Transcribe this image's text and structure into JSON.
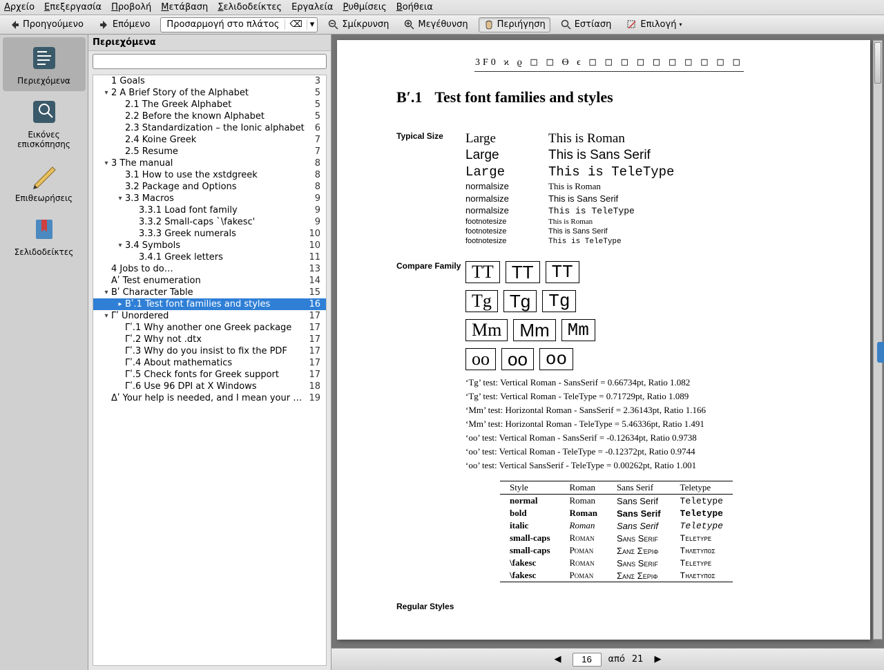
{
  "menus": [
    "Αρχείο",
    "Επεξεργασία",
    "Προβολή",
    "Μετάβαση",
    "Σελιδοδείκτες",
    "Εργαλεία",
    "Ρυθμίσεις",
    "Βοήθεια"
  ],
  "menu_ul": [
    0,
    0,
    0,
    0,
    0,
    -1,
    0,
    0
  ],
  "toolbar": {
    "prev": "Προηγούμενο",
    "next": "Επόμενο",
    "zoom_value": "Προσαρμογή στο πλάτος",
    "zoom_out": "Σμίκρυνση",
    "zoom_in": "Μεγέθυνση",
    "browse": "Περιήγηση",
    "focus": "Εστίαση",
    "select": "Επιλογή"
  },
  "leftbar": [
    {
      "key": "contents",
      "label": "Περιεχόμενα",
      "active": true
    },
    {
      "key": "thumbs",
      "label": "Εικόνες επισκόπησης",
      "active": false
    },
    {
      "key": "reviews",
      "label": "Επιθεωρήσεις",
      "active": false
    },
    {
      "key": "bookmarks",
      "label": "Σελιδοδείκτες",
      "active": false
    }
  ],
  "side": {
    "title": "Περιεχόμενα",
    "search_placeholder": "",
    "tree": [
      {
        "d": 0,
        "a": "",
        "t": "1 Goals",
        "p": 3
      },
      {
        "d": 0,
        "a": "▾",
        "t": "2 A Brief Story of the Alphabet",
        "p": 5
      },
      {
        "d": 1,
        "a": "",
        "t": "2.1 The Greek Alphabet",
        "p": 5
      },
      {
        "d": 1,
        "a": "",
        "t": "2.2 Before the known Alphabet",
        "p": 5
      },
      {
        "d": 1,
        "a": "",
        "t": "2.3 Standardization – the Ionic alphabet",
        "p": 6
      },
      {
        "d": 1,
        "a": "",
        "t": "2.4 Koine Greek",
        "p": 7
      },
      {
        "d": 1,
        "a": "",
        "t": "2.5 Resume",
        "p": 7
      },
      {
        "d": 0,
        "a": "▾",
        "t": "3 The manual",
        "p": 8
      },
      {
        "d": 1,
        "a": "",
        "t": "3.1 How to use the xstdgreek",
        "p": 8
      },
      {
        "d": 1,
        "a": "",
        "t": "3.2 Package and Options",
        "p": 8
      },
      {
        "d": 1,
        "a": "▾",
        "t": "3.3 Macros",
        "p": 9
      },
      {
        "d": 2,
        "a": "",
        "t": "3.3.1 Load font family",
        "p": 9
      },
      {
        "d": 2,
        "a": "",
        "t": "3.3.2 Small-caps `\\fakesc'",
        "p": 9
      },
      {
        "d": 2,
        "a": "",
        "t": "3.3.3 Greek numerals",
        "p": 10
      },
      {
        "d": 1,
        "a": "▾",
        "t": "3.4 Symbols",
        "p": 10
      },
      {
        "d": 2,
        "a": "",
        "t": "3.4.1 Greek letters",
        "p": 11
      },
      {
        "d": 0,
        "a": "",
        "t": "4 Jobs to do…",
        "p": 13
      },
      {
        "d": 0,
        "a": "",
        "t": "Αʹ Test enumeration",
        "p": 14
      },
      {
        "d": 0,
        "a": "▾",
        "t": "Βʹ Character Table",
        "p": 15
      },
      {
        "d": 1,
        "a": "▸",
        "t": "Βʹ.1 Test font families and styles",
        "p": 16,
        "sel": true
      },
      {
        "d": 0,
        "a": "▾",
        "t": "Γʹ Unordered",
        "p": 17
      },
      {
        "d": 1,
        "a": "",
        "t": "Γʹ.1 Why another one Greek package",
        "p": 17
      },
      {
        "d": 1,
        "a": "",
        "t": "Γʹ.2 Why not .dtx",
        "p": 17
      },
      {
        "d": 1,
        "a": "",
        "t": "Γʹ.3 Why do you insist to fix the PDF",
        "p": 17
      },
      {
        "d": 1,
        "a": "",
        "t": "Γʹ.4 About mathematics",
        "p": 17
      },
      {
        "d": 1,
        "a": "",
        "t": "Γʹ.5 Check fonts for Greek support",
        "p": 17
      },
      {
        "d": 1,
        "a": "",
        "t": "Γʹ.6 Use 96 DPI at X Windows",
        "p": 18
      },
      {
        "d": 0,
        "a": "",
        "t": "Δʹ Your help is needed, and I mean your feedback",
        "p": 19
      }
    ]
  },
  "doc": {
    "glyphrow": "3F0   ϰ   ϱ   ◻   ◻   ϴ   ϵ   ◻   ◻   ◻   ◻   ◻   ◻   ◻   ◻   ◻   ◻",
    "heading_num": "Βʹ.1",
    "heading_txt": "Test font families and styles",
    "labels": {
      "typical": "Typical Size",
      "compare": "Compare Family",
      "regular": "Regular Styles"
    },
    "sizes": [
      {
        "size": "Large",
        "cls": "lg",
        "fam": "rm",
        "txt": "This is Roman"
      },
      {
        "size": "Large",
        "cls": "lg",
        "fam": "ss",
        "txt": "This is Sans Serif"
      },
      {
        "size": "Large",
        "cls": "lg",
        "fam": "tt",
        "txt": "This is TeleType"
      },
      {
        "size": "normalsize",
        "cls": "ns",
        "fam": "rm",
        "txt": "This is Roman"
      },
      {
        "size": "normalsize",
        "cls": "ns",
        "fam": "ss",
        "txt": "This is Sans Serif"
      },
      {
        "size": "normalsize",
        "cls": "ns",
        "fam": "tt",
        "txt": "This is TeleType"
      },
      {
        "size": "footnotesize",
        "cls": "fs",
        "fam": "rm",
        "txt": "This is Roman"
      },
      {
        "size": "footnotesize",
        "cls": "fs",
        "fam": "ss",
        "txt": "This is Sans Serif"
      },
      {
        "size": "footnotesize",
        "cls": "fs",
        "fam": "tt",
        "txt": "This is TeleType"
      }
    ],
    "boxes": [
      [
        "TT",
        "TT",
        "TT"
      ],
      [
        "Tg",
        "Tg",
        "Tg"
      ],
      [
        "Mm",
        "Mm",
        "Mm"
      ],
      [
        "oo",
        "oo",
        "oo"
      ]
    ],
    "tests": [
      "‘Tg’ test: Vertical Roman - SansSerif = 0.66734pt, Ratio 1.082",
      "‘Tg’ test: Vertical Roman - TeleType = 0.71729pt, Ratio 1.089",
      "‘Mm’ test: Horizontal Roman - SansSerif = 2.36143pt, Ratio 1.166",
      "‘Mm’ test: Horizontal Roman - TeleType = 5.46336pt, Ratio 1.491",
      "‘oo’ test: Vertical Roman - SansSerif = -0.12634pt, Ratio 0.9738",
      "‘oo’ test: Vertical Roman - TeleType = -0.12372pt, Ratio 0.9744",
      "‘oo’ test: Vertical SansSerif - TeleType = 0.00262pt, Ratio 1.001"
    ],
    "table": {
      "headers": [
        "Style",
        "Roman",
        "Sans Serif",
        "Teletype"
      ],
      "rows": [
        {
          "s": "normal",
          "r": "Roman",
          "ss": "Sans Serif",
          "tt": "Teletype",
          "st": ""
        },
        {
          "s": "bold",
          "r": "Roman",
          "ss": "Sans Serif",
          "tt": "Teletype",
          "st": "font-weight:bold"
        },
        {
          "s": "italic",
          "r": "Roman",
          "ss": "Sans Serif",
          "tt": "Teletype",
          "st": "font-style:italic"
        },
        {
          "s": "small-caps",
          "r": "Roman",
          "ss": "Sans Serif",
          "tt": "Teletype",
          "st": "",
          "sc": true
        },
        {
          "s": "small-caps",
          "r": "Ρόμαν",
          "ss": "Σανς Σέριφ",
          "tt": "Τηλέτυπος",
          "st": "",
          "sc": true
        },
        {
          "s": "\\fakesc",
          "r": "Roman",
          "ss": "Sans Serif",
          "tt": "Teletype",
          "st": "",
          "sc": true
        },
        {
          "s": "\\fakesc",
          "r": "Ροman",
          "ss": "Σανς Σεριφ",
          "tt": "Τηλετυποσ",
          "st": "",
          "sc": true
        }
      ]
    }
  },
  "pager": {
    "current": "16",
    "sep": "από",
    "total": "21"
  }
}
